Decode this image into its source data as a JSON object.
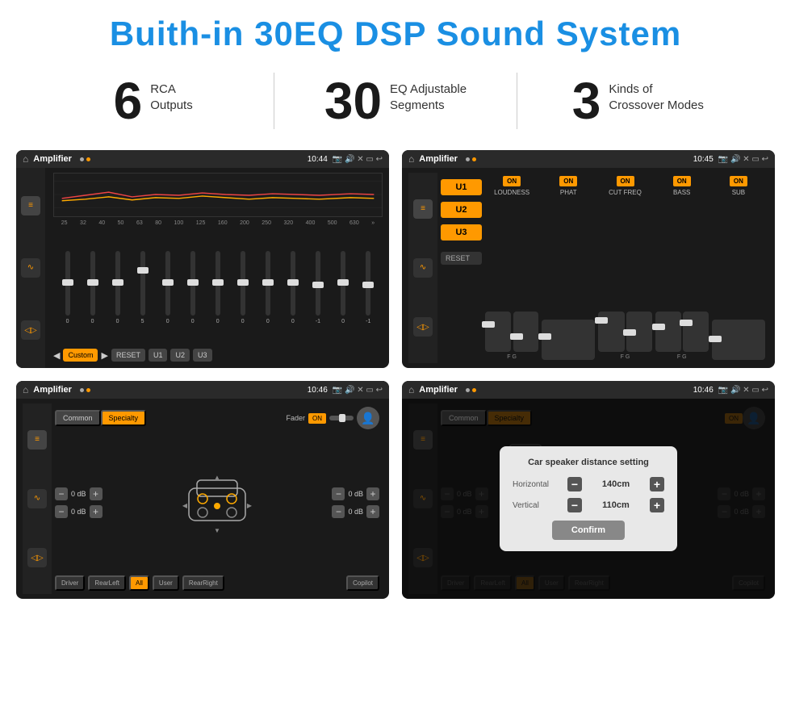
{
  "header": {
    "title": "Buith-in 30EQ DSP Sound System"
  },
  "stats": [
    {
      "number": "6",
      "label_line1": "RCA",
      "label_line2": "Outputs"
    },
    {
      "number": "30",
      "label_line1": "EQ Adjustable",
      "label_line2": "Segments"
    },
    {
      "number": "3",
      "label_line1": "Kinds of",
      "label_line2": "Crossover Modes"
    }
  ],
  "screens": [
    {
      "id": "screen1",
      "status_bar": {
        "app": "Amplifier",
        "time": "10:44"
      },
      "type": "eq"
    },
    {
      "id": "screen2",
      "status_bar": {
        "app": "Amplifier",
        "time": "10:45"
      },
      "type": "amp2"
    },
    {
      "id": "screen3",
      "status_bar": {
        "app": "Amplifier",
        "time": "10:46"
      },
      "type": "common"
    },
    {
      "id": "screen4",
      "status_bar": {
        "app": "Amplifier",
        "time": "10:46"
      },
      "type": "dialog",
      "dialog": {
        "title": "Car speaker distance setting",
        "horizontal_label": "Horizontal",
        "horizontal_value": "140cm",
        "vertical_label": "Vertical",
        "vertical_value": "110cm",
        "confirm_label": "Confirm"
      }
    }
  ],
  "eq": {
    "frequencies": [
      "25",
      "32",
      "40",
      "50",
      "63",
      "80",
      "100",
      "125",
      "160",
      "200",
      "250",
      "320",
      "400",
      "500",
      "630"
    ],
    "values": [
      "0",
      "0",
      "0",
      "5",
      "0",
      "0",
      "0",
      "0",
      "0",
      "0",
      "-1",
      "0",
      "-1"
    ],
    "presets": [
      "Custom",
      "RESET",
      "U1",
      "U2",
      "U3"
    ]
  },
  "amp2": {
    "channels": [
      "LOUDNESS",
      "PHAT",
      "CUT FREQ",
      "BASS",
      "SUB"
    ],
    "u_buttons": [
      "U1",
      "U2",
      "U3"
    ]
  },
  "common": {
    "tabs": [
      "Common",
      "Specialty"
    ],
    "fader_label": "Fader",
    "fader_on": "ON",
    "bottom_buttons": [
      "Driver",
      "RearLeft",
      "All",
      "User",
      "RearRight",
      "Copilot"
    ]
  },
  "dialog": {
    "title": "Car speaker distance setting",
    "horizontal_label": "Horizontal",
    "horizontal_value": "140cm",
    "vertical_label": "Vertical",
    "vertical_value": "110cm",
    "confirm_label": "Confirm"
  }
}
